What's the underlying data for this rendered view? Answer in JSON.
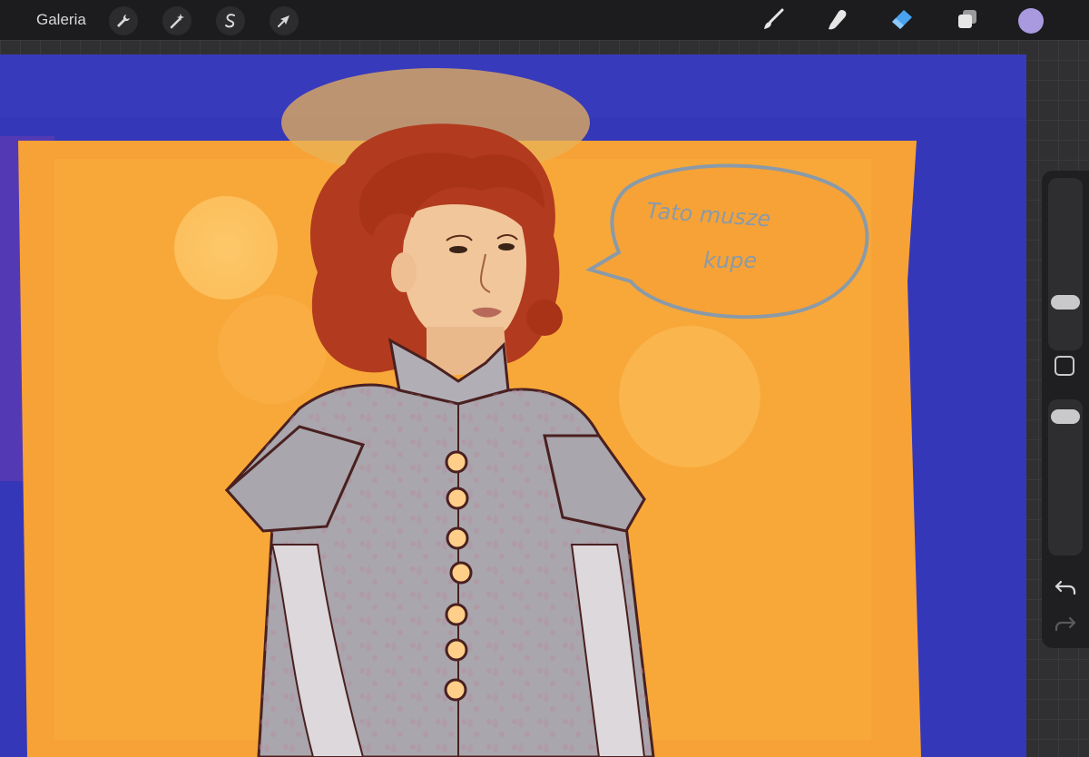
{
  "toolbar": {
    "gallery_label": "Galeria",
    "actions_icon": "wrench-icon",
    "adjustments_icon": "magic-wand-icon",
    "selection_icon": "selection-s-icon",
    "transform_icon": "arrow-cursor-icon",
    "tools": [
      {
        "name": "brush-icon",
        "active": false
      },
      {
        "name": "smudge-icon",
        "active": false
      },
      {
        "name": "eraser-icon",
        "active": true
      },
      {
        "name": "layers-icon",
        "active": false
      }
    ],
    "current_color": "#a99ae0"
  },
  "canvas": {
    "speech_bubble_line1": "Tato musze",
    "speech_bubble_line2": "kupe",
    "colors": {
      "blue": "#3437b8",
      "orange": "#f7a236",
      "hair": "#b23a1e",
      "coat": "#a9a6ad",
      "bubble": "#8a9aa8"
    }
  },
  "sidebar": {
    "size_slider_level": 0.75,
    "opacity_slider_level": 0.05,
    "undo_icon": "undo-icon",
    "redo_icon": "redo-icon",
    "modify_icon": "square-icon"
  },
  "accent": "#4aa3f0"
}
